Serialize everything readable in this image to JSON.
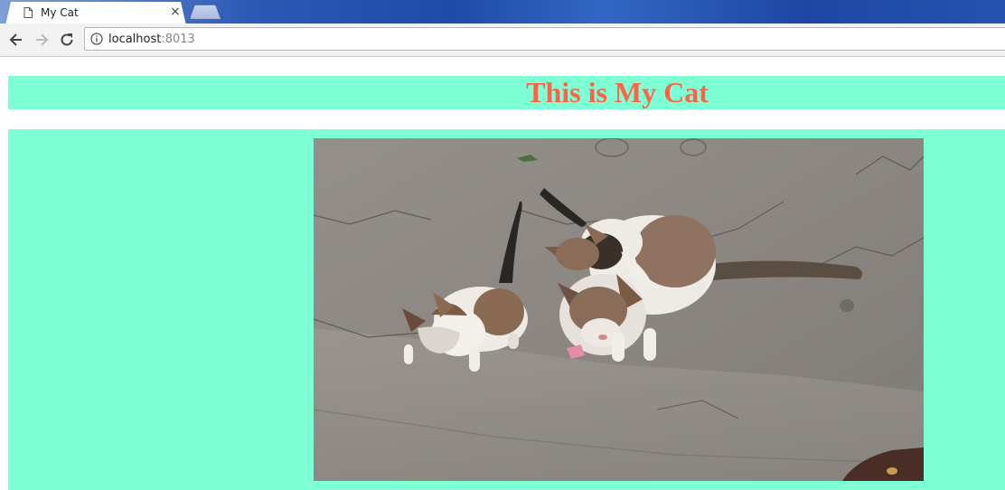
{
  "browser": {
    "tab": {
      "title": "My Cat",
      "close_glyph": "×",
      "icon": "page-icon"
    },
    "toolbar": {
      "back_icon": "arrow-left-icon",
      "forward_icon": "arrow-right-icon",
      "reload_icon": "reload-icon",
      "url_host": "localhost",
      "url_port": ":8013",
      "security_icon": "info-icon"
    }
  },
  "page": {
    "title": "This is My Cat",
    "image": {
      "description_name": "cat-photo"
    }
  },
  "colors": {
    "band_background": "#7fffd4",
    "title_color": "#ff6347"
  }
}
